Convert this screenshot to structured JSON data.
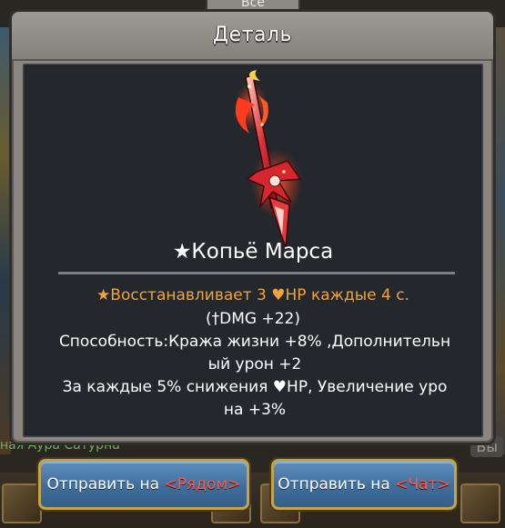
{
  "background": {
    "top_tab": "Все",
    "left_text": "ная Аура Сатурна",
    "right_text": "Вы"
  },
  "dialog": {
    "title": "Деталь",
    "item": {
      "icon": "spear-of-mars",
      "name": "★Копьё Марса"
    },
    "effect": {
      "star": "★",
      "text": "Восстанавливает 3 ",
      "heart": "♥",
      "suffix": "HP каждые 4 с."
    },
    "stat": {
      "open": "(",
      "icon": "†",
      "text": "DMG +22)"
    },
    "description": {
      "line1": "Способность:Кража жизни +8% ,Дополнительн",
      "line2": "ый урон +2",
      "line3_prefix": "За каждые 5% снижения ",
      "line3_heart": "♥",
      "line3_suffix": "HP, Увеличение уро",
      "line4": "на +3%"
    }
  },
  "buttons": {
    "nearby": {
      "prefix": "Отправить на ",
      "target": "<Рядом>"
    },
    "chat": {
      "prefix": "Отправить на ",
      "target": "<Чат>"
    }
  },
  "colors": {
    "effect_orange": "#f0a33a",
    "target_red": "#ff5a4a",
    "button_blue": "#3f6e9c",
    "button_border_gold": "#c6a24a"
  }
}
